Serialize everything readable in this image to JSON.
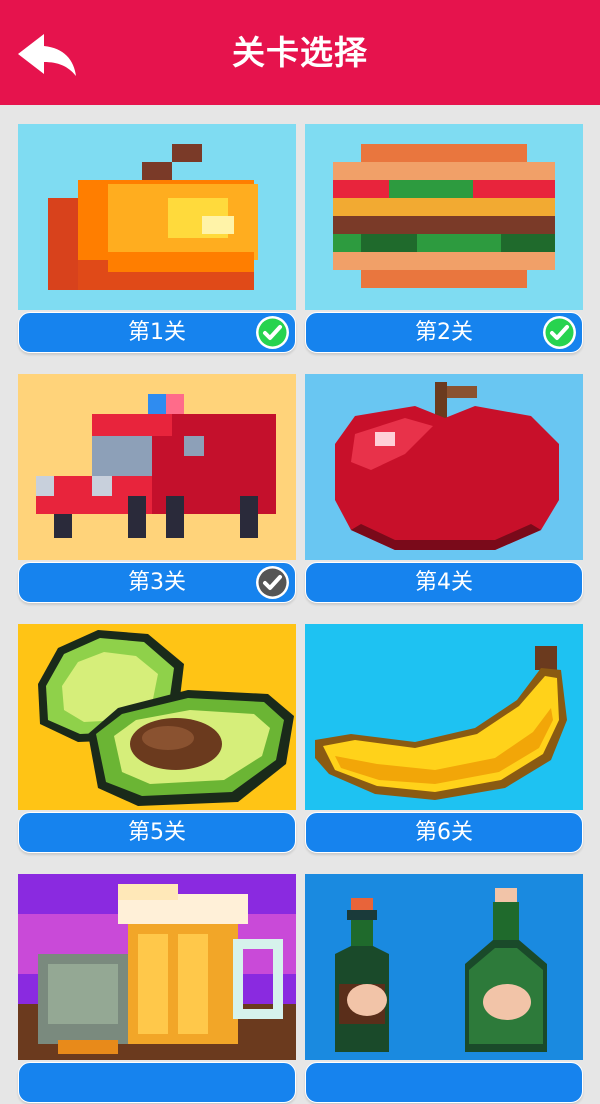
{
  "header": {
    "title": "关卡选择",
    "back_icon": "back-arrow-icon"
  },
  "levels": [
    {
      "label": "第1关",
      "status": "completed",
      "image": "taco",
      "badge_color": "#27d34f"
    },
    {
      "label": "第2关",
      "status": "completed",
      "image": "sandwich",
      "badge_color": "#27d34f"
    },
    {
      "label": "第3关",
      "status": "in-progress",
      "image": "truck",
      "badge_color": "#555555"
    },
    {
      "label": "第4关",
      "status": "locked",
      "image": "apple"
    },
    {
      "label": "第5关",
      "status": "locked",
      "image": "avocado"
    },
    {
      "label": "第6关",
      "status": "locked",
      "image": "banana"
    },
    {
      "label": "",
      "status": "locked",
      "image": "beer"
    },
    {
      "label": "",
      "status": "locked",
      "image": "bottles"
    }
  ],
  "colors": {
    "header": "#e6134d",
    "label_bar": "#1683ee",
    "background": "#e6e6e6"
  }
}
